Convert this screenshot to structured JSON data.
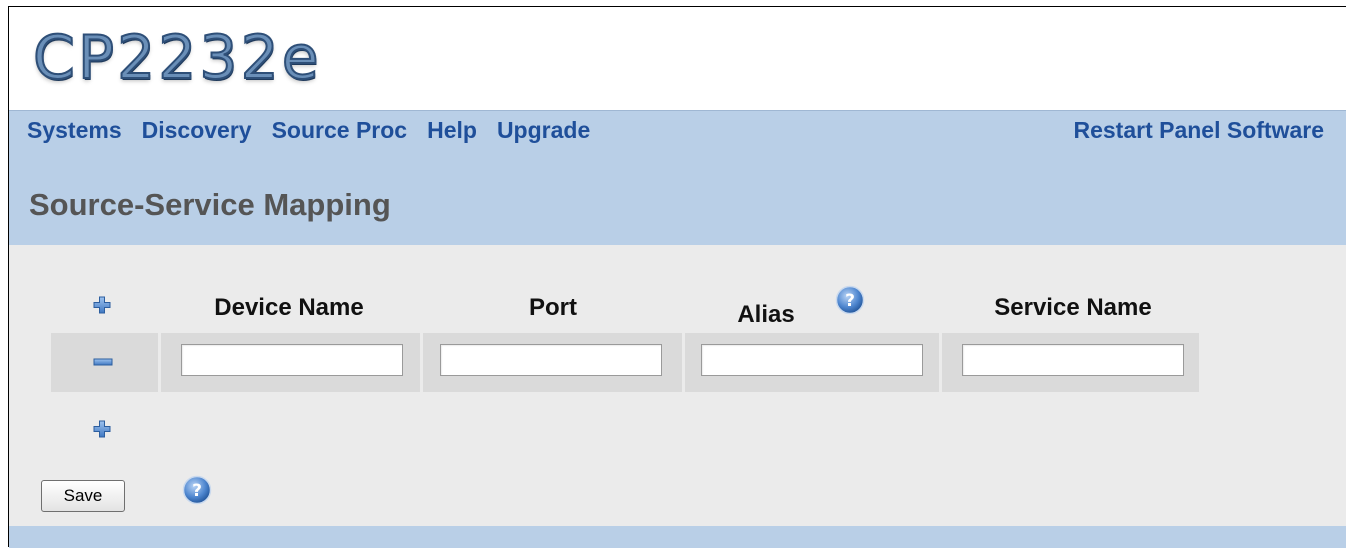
{
  "app": {
    "logo_text": "CP2232e"
  },
  "nav": {
    "items": [
      {
        "label": "Systems"
      },
      {
        "label": "Discovery"
      },
      {
        "label": "Source Proc"
      },
      {
        "label": "Help"
      },
      {
        "label": "Upgrade"
      }
    ],
    "right_link": "Restart Panel Software"
  },
  "page": {
    "title": "Source-Service Mapping"
  },
  "table": {
    "columns": [
      "Device Name",
      "Port",
      "Alias",
      "Service Name"
    ],
    "rows": [
      {
        "device_name": "",
        "port": "",
        "alias": "",
        "service_name": ""
      }
    ]
  },
  "actions": {
    "save_label": "Save"
  },
  "icons": {
    "add_row": "plus-icon",
    "remove_row": "minus-icon",
    "help": "help-icon"
  },
  "colors": {
    "nav_background": "#b9cfe7",
    "link": "#1f4f9a",
    "title_text": "#555555",
    "content_background": "#ebebeb",
    "row_background": "#dadada"
  }
}
